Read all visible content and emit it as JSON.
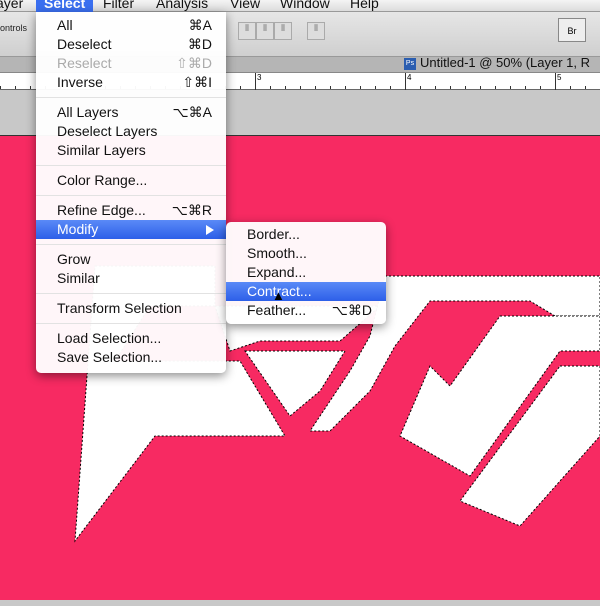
{
  "menubar": {
    "items": [
      "ayer",
      "Select",
      "Filter",
      "Analysis",
      "View",
      "Window",
      "Help"
    ]
  },
  "options": {
    "label": "ontrols",
    "bridge": "Br"
  },
  "document": {
    "tab_title": "Untitled-1 @ 50% (Layer 1, R",
    "ps": "Ps"
  },
  "ruler": {
    "marks": [
      "3",
      "4",
      "5"
    ]
  },
  "select_menu": {
    "all": {
      "label": "All",
      "shortcut": "⌘A"
    },
    "deselect": {
      "label": "Deselect",
      "shortcut": "⌘D"
    },
    "reselect": {
      "label": "Reselect",
      "shortcut": "⇧⌘D"
    },
    "inverse": {
      "label": "Inverse",
      "shortcut": "⇧⌘I"
    },
    "all_layers": {
      "label": "All Layers",
      "shortcut": "⌥⌘A"
    },
    "deselect_layers": {
      "label": "Deselect Layers"
    },
    "similar_layers": {
      "label": "Similar Layers"
    },
    "color_range": {
      "label": "Color Range..."
    },
    "refine_edge": {
      "label": "Refine Edge...",
      "shortcut": "⌥⌘R"
    },
    "modify": {
      "label": "Modify"
    },
    "grow": {
      "label": "Grow"
    },
    "similar": {
      "label": "Similar"
    },
    "transform": {
      "label": "Transform Selection"
    },
    "load": {
      "label": "Load Selection..."
    },
    "save": {
      "label": "Save Selection..."
    }
  },
  "modify_menu": {
    "border": {
      "label": "Border..."
    },
    "smooth": {
      "label": "Smooth..."
    },
    "expand": {
      "label": "Expand..."
    },
    "contract": {
      "label": "Contract..."
    },
    "feather": {
      "label": "Feather...",
      "shortcut": "⌥⌘D"
    }
  },
  "colors": {
    "canvas": "#f72a62",
    "highlight": "#2d5fe8"
  }
}
